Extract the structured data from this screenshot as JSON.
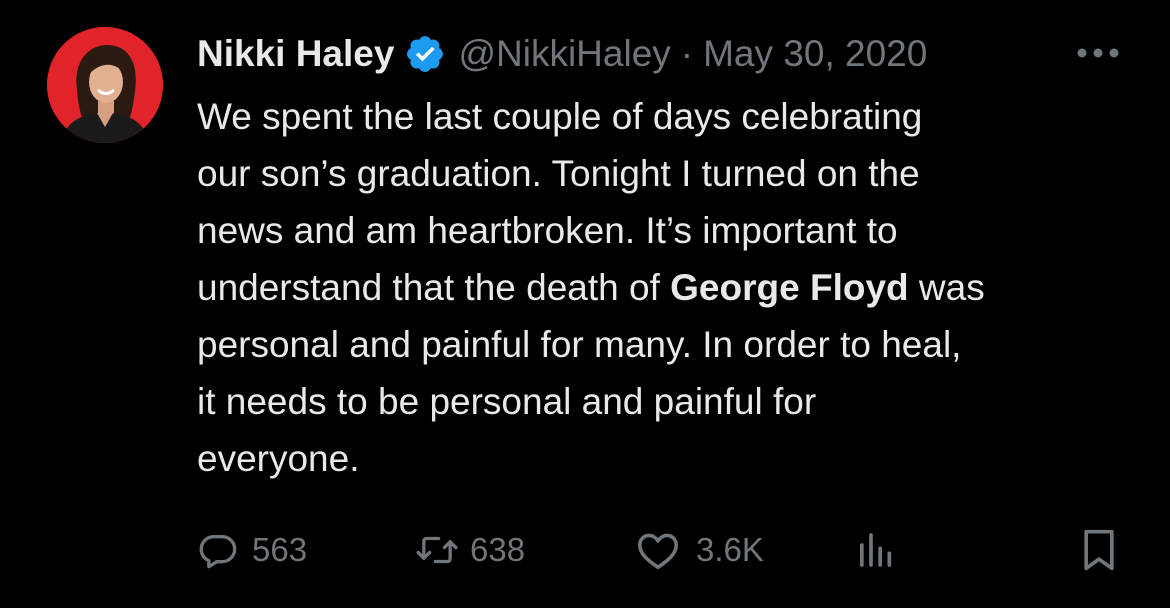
{
  "tweet": {
    "author": {
      "display_name": "Nikki Haley",
      "handle": "@NikkiHaley",
      "verified": true
    },
    "separator": "·",
    "date": "May 30, 2020",
    "text_lines": [
      {
        "parts": [
          {
            "text": "We spent the last couple of days celebrating",
            "bold": false
          }
        ]
      },
      {
        "parts": [
          {
            "text": "our son’s graduation. Tonight I turned on the",
            "bold": false
          }
        ]
      },
      {
        "parts": [
          {
            "text": "news and am heartbroken. It’s important to",
            "bold": false
          }
        ]
      },
      {
        "parts": [
          {
            "text": "understand that the death of ",
            "bold": false
          },
          {
            "text": "George Floyd",
            "bold": true
          },
          {
            "text": " was",
            "bold": false
          }
        ]
      },
      {
        "parts": [
          {
            "text": "personal and painful for many. In order to heal,",
            "bold": false
          }
        ]
      },
      {
        "parts": [
          {
            "text": "it needs to be personal and painful for",
            "bold": false
          }
        ]
      },
      {
        "parts": [
          {
            "text": "everyone.",
            "bold": false
          }
        ]
      }
    ],
    "stats": {
      "replies": "563",
      "retweets": "638",
      "likes": "3.6K"
    },
    "icons": {
      "reply": "reply-icon",
      "retweet": "retweet-icon",
      "like": "heart-icon",
      "views": "analytics-icon",
      "bookmark": "bookmark-icon",
      "more": "more-icon",
      "verified": "verified-badge-icon"
    }
  },
  "colors": {
    "background": "#000000",
    "text_primary": "#e7e9ea",
    "text_secondary": "#71767b",
    "verified_blue": "#1d9bf0",
    "avatar_background": "#e0242a"
  }
}
